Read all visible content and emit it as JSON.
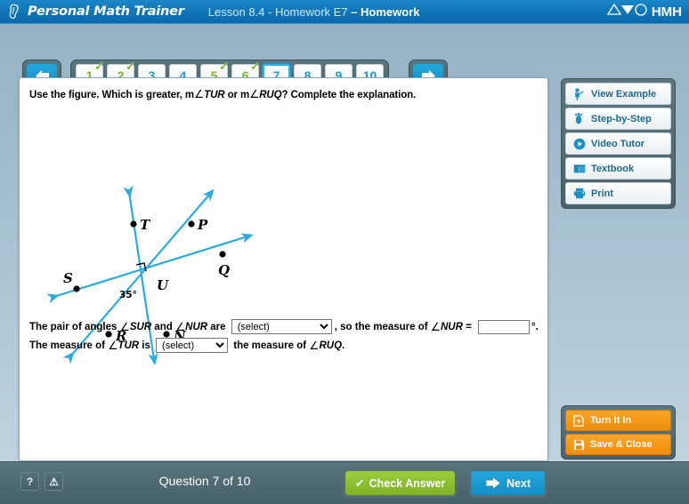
{
  "header": {
    "brand": "Personal Math Trainer",
    "brand_icon": "pencil-flask-icon",
    "lesson_prefix": "Lesson 8.4 - Homework E7 ",
    "lesson_dash": "– ",
    "lesson_suffix": "Homework",
    "logo_text": "HMH",
    "logo_glyphs": "△▽○",
    "bg_color": "#0f74b8"
  },
  "nav": {
    "prev_label": "previous-question",
    "next_label": "next-question",
    "questions": [
      {
        "label": "1",
        "state": "done"
      },
      {
        "label": "2",
        "state": "done"
      },
      {
        "label": "3",
        "state": "todo"
      },
      {
        "label": "4",
        "state": "todo"
      },
      {
        "label": "5",
        "state": "done"
      },
      {
        "label": "6",
        "state": "done"
      },
      {
        "label": "7",
        "state": "current"
      },
      {
        "label": "8",
        "state": "todo"
      },
      {
        "label": "9",
        "state": "todo"
      },
      {
        "label": "10",
        "state": "todo"
      }
    ],
    "check_glyph": "✓",
    "done_color": "#77b62b",
    "todo_color": "#1f9ad4",
    "current_border": "#2ab5ef"
  },
  "question": {
    "prompt_a": "Use the figure. Which is greater, m",
    "prompt_angle1": "∠",
    "prompt_b": "TUR",
    "prompt_c": " or m",
    "prompt_angle2": "∠",
    "prompt_d": "RUQ",
    "prompt_e": "? Complete the explanation."
  },
  "figure": {
    "points": [
      "T",
      "P",
      "Q",
      "S",
      "U",
      "R",
      "N"
    ],
    "angle_label": "35°",
    "right_angle_marker": "right-angle-square",
    "line_color": "#29ABE2",
    "label_color": "#000000"
  },
  "answer": {
    "line1_a": "The pair of angles ",
    "line1_ang1": "∠",
    "line1_b": "SUR",
    "line1_c": " and ",
    "line1_ang2": "∠",
    "line1_d": "NUR",
    "line1_e": " are ",
    "select1_value": "(select)",
    "line1_f": ", so the measure of ",
    "line1_ang3": "∠",
    "line1_g": "NUR",
    "line1_h": " = ",
    "input_value": "",
    "input_unit": "°.",
    "line2_a": "The measure of ",
    "line2_ang1": "∠",
    "line2_b": "TUR",
    "line2_c": " is ",
    "select2_value": "(select)",
    "line2_d": " the measure of ",
    "line2_ang2": "∠",
    "line2_e": "RUQ",
    "line2_f": "."
  },
  "tools": [
    {
      "label": "View Example",
      "icon": "person-pointing-icon"
    },
    {
      "label": "Step-by-Step",
      "icon": "footprint-icon"
    },
    {
      "label": "Video Tutor",
      "icon": "play-circle-icon"
    },
    {
      "label": "Textbook",
      "icon": "book-icon"
    },
    {
      "label": "Print",
      "icon": "printer-icon"
    }
  ],
  "actions": [
    {
      "label": "Turn It In",
      "icon": "upload-document-icon",
      "color": "#f79520"
    },
    {
      "label": "Save & Close",
      "icon": "floppy-disk-icon",
      "color": "#f79520"
    }
  ],
  "footer": {
    "help_glyph": "?",
    "warn_glyph": "⚠",
    "counter": "Question 7 of 10",
    "check_label": "Check Answer",
    "check_glyph": "✔",
    "check_color": "#8CC63E",
    "next_label": "Next",
    "next_color": "#1C9AD6"
  }
}
